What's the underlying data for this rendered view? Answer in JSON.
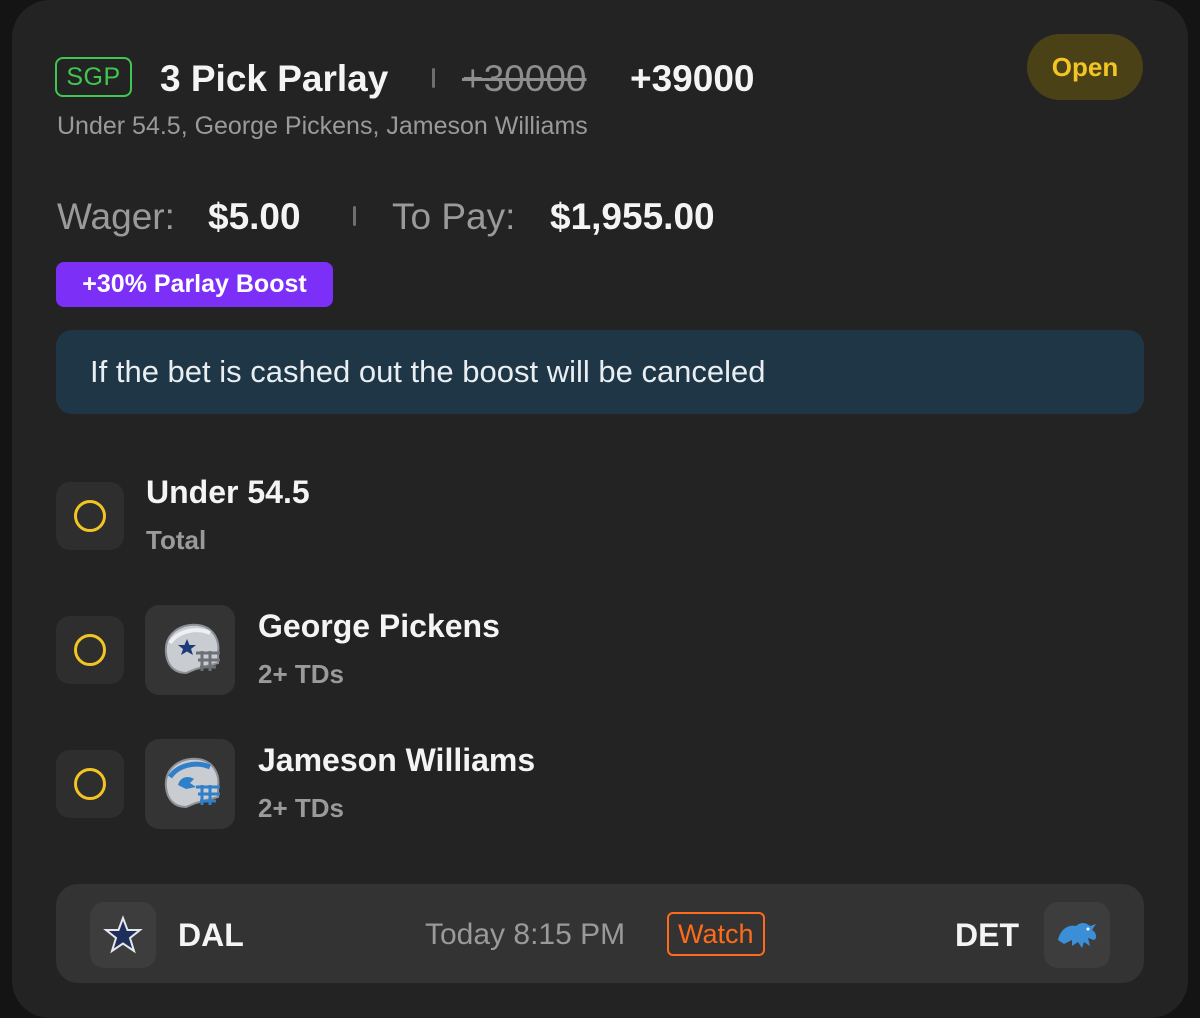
{
  "bet": {
    "tag": "SGP",
    "title": "3 Pick Parlay",
    "original_odds": "+30000",
    "boosted_odds": "+39000",
    "status": "Open",
    "subtitle": "Under 54.5, George Pickens, Jameson Williams"
  },
  "wager": {
    "wager_label": "Wager:",
    "wager_value": "$5.00",
    "pay_label": "To Pay:",
    "pay_value": "$1,955.00"
  },
  "boost": {
    "label": "+30% Parlay Boost",
    "notice": "If the bet is cashed out the boost will be canceled"
  },
  "legs": [
    {
      "title": "Under 54.5",
      "sub": "Total",
      "icon": "none"
    },
    {
      "title": "George Pickens",
      "sub": "2+ TDs",
      "icon": "cowboys-helmet-icon"
    },
    {
      "title": "Jameson Williams",
      "sub": "2+ TDs",
      "icon": "lions-helmet-icon"
    }
  ],
  "game": {
    "away": "DAL",
    "home": "DET",
    "time": "Today 8:15 PM",
    "watch_label": "Watch"
  },
  "colors": {
    "accent_green": "#3fc74f",
    "status_yellow": "#f2c524",
    "boost_purple": "#7b2ff7",
    "watch_orange": "#ff6b1a",
    "notice_bg": "#1f3646"
  }
}
